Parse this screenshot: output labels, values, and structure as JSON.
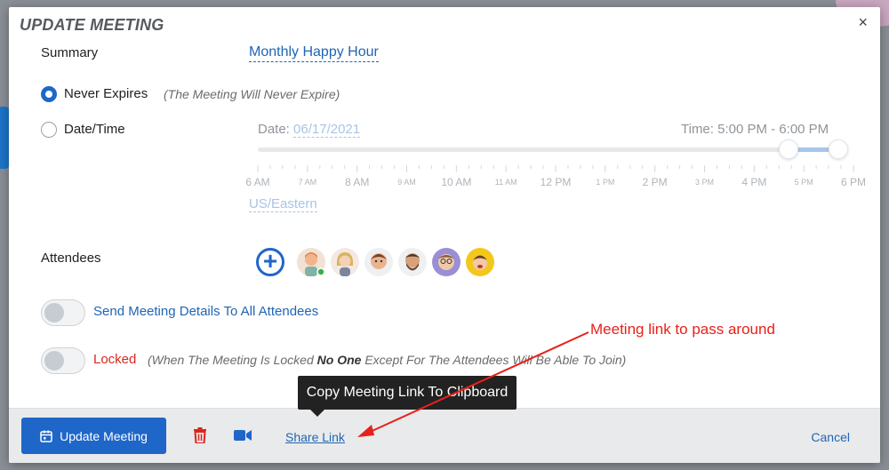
{
  "dialog": {
    "title": "UPDATE MEETING",
    "close_icon": "×"
  },
  "summary": {
    "label": "Summary",
    "value": "Monthly Happy Hour"
  },
  "expiry": {
    "never_label": "Never Expires",
    "never_hint": "(The Meeting Will Never Expire)",
    "never_selected": true,
    "datetime_label": "Date/Time",
    "date_prefix": "Date:",
    "date_value": "06/17/2021",
    "time_label": "Time: 5:00 PM - 6:00 PM",
    "timezone": "US/Eastern",
    "ticks": [
      {
        "label": "6 AM",
        "small": false
      },
      {
        "label": "7 AM",
        "small": true
      },
      {
        "label": "8 AM",
        "small": false
      },
      {
        "label": "9 AM",
        "small": true
      },
      {
        "label": "10 AM",
        "small": false
      },
      {
        "label": "11 AM",
        "small": true
      },
      {
        "label": "12 PM",
        "small": false
      },
      {
        "label": "1 PM",
        "small": true
      },
      {
        "label": "2 PM",
        "small": false
      },
      {
        "label": "3 PM",
        "small": true
      },
      {
        "label": "4 PM",
        "small": false
      },
      {
        "label": "5 PM",
        "small": true
      },
      {
        "label": "6 PM",
        "small": false
      }
    ]
  },
  "attendees": {
    "label": "Attendees",
    "add_icon": "+",
    "avatars": [
      "avatar-1",
      "avatar-2",
      "avatar-3",
      "avatar-4",
      "avatar-5",
      "avatar-6"
    ]
  },
  "options": {
    "send_details_label": "Send Meeting Details To All Attendees",
    "send_details_on": false,
    "locked_label": "Locked",
    "locked_on": false,
    "locked_hint_a": "(When The Meeting Is Locked ",
    "locked_hint_bold": "No One",
    "locked_hint_b": " Except For The Attendees Will Be Able To Join)"
  },
  "footer": {
    "update_label": "Update Meeting",
    "share_label": "Share Link",
    "cancel_label": "Cancel"
  },
  "tooltip": {
    "text": "Copy Meeting Link To Clipboard"
  },
  "annotation": {
    "text": "Meeting link to pass around"
  },
  "colors": {
    "primary": "#1f66c9",
    "danger": "#d9271f",
    "annotation": "#e8201a"
  }
}
